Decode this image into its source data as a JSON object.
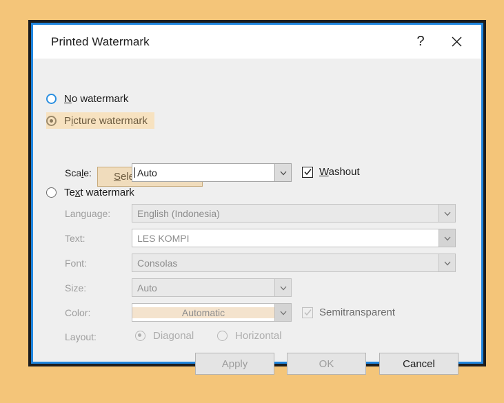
{
  "window": {
    "title": "Printed Watermark",
    "help_label": "?",
    "close_label": "✕"
  },
  "watermark_type": {
    "none_label": "No watermark",
    "picture_label": "Picture watermark",
    "text_label": "Text watermark",
    "selected": "picture"
  },
  "picture_section": {
    "select_picture_label": "Select Picture...",
    "scale_label": "Scale:",
    "scale_value": "Auto",
    "washout_label": "Washout",
    "washout_checked": "true"
  },
  "text_section": {
    "language_label": "Language:",
    "language_value": "English (Indonesia)",
    "text_label": "Text:",
    "text_value": "LES KOMPI",
    "font_label": "Font:",
    "font_value": "Consolas",
    "size_label": "Size:",
    "size_value": "Auto",
    "color_label": "Color:",
    "color_value": "Automatic",
    "semitransparent_label": "Semitransparent",
    "semitransparent_checked": "true",
    "layout_label": "Layout:",
    "layout_diagonal_label": "Diagonal",
    "layout_horizontal_label": "Horizontal",
    "layout_selected": "Diagonal"
  },
  "footer": {
    "apply_label": "Apply",
    "ok_label": "OK",
    "cancel_label": "Cancel"
  },
  "colors": {
    "page_background": "#f4c579",
    "dialog_frame": "#1d1d1d",
    "dialog_accent_border": "#1f85de",
    "dialog_body": "#efefef",
    "titlebar": "#ffffff",
    "hover_highlight": "#f7e2c0",
    "hover_text": "#6b5a3e",
    "disabled_text": "#9d9d9d"
  }
}
